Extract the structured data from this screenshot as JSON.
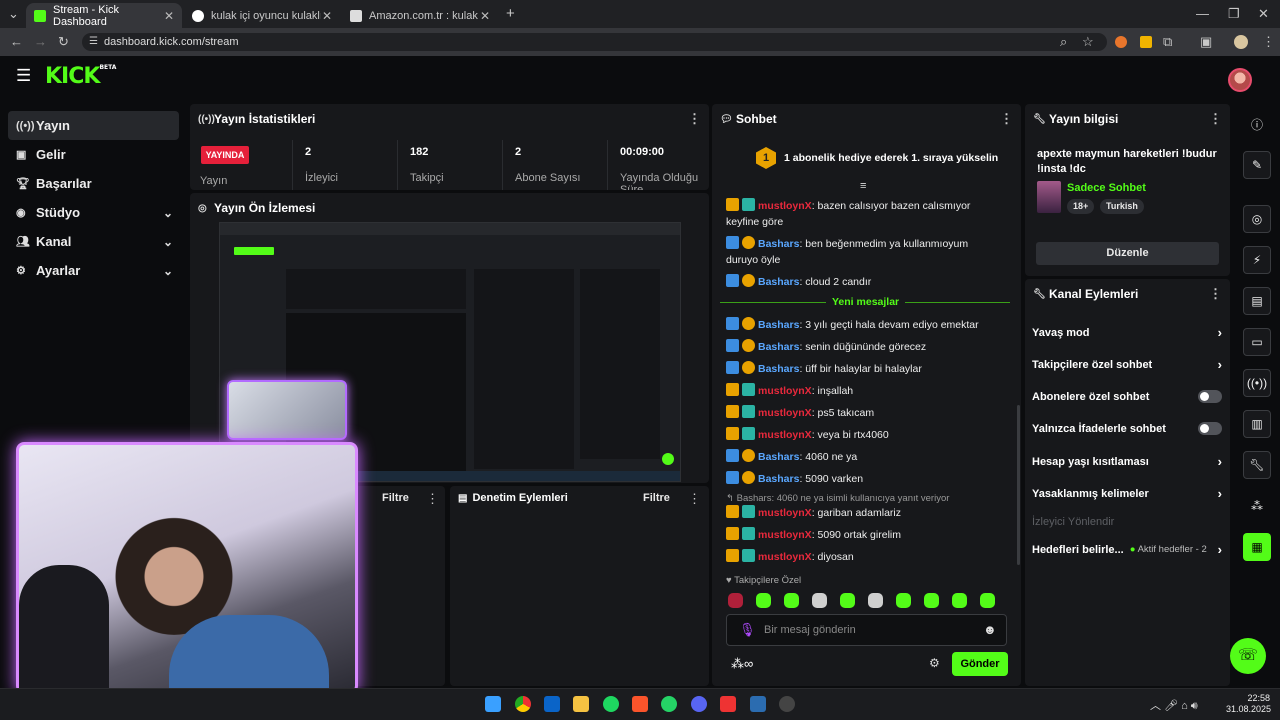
{
  "browser": {
    "tabs": [
      {
        "title": "Stream - Kick Dashboard",
        "active": true
      },
      {
        "title": "kulak içi oyuncu kulaklığı - Goo",
        "active": false
      },
      {
        "title": "Amazon.com.tr : kulak içi oyunc",
        "active": false
      }
    ],
    "url": "dashboard.kick.com/stream"
  },
  "logo": {
    "text": "KICK",
    "beta": "BETA"
  },
  "nav": [
    {
      "label": "Yayın",
      "icon": "broadcast-icon"
    },
    {
      "label": "Gelir",
      "icon": "revenue-icon"
    },
    {
      "label": "Başarılar",
      "icon": "trophy-icon"
    },
    {
      "label": "Stüdyo",
      "icon": "studio-icon"
    },
    {
      "label": "Kanal",
      "icon": "channel-icon"
    },
    {
      "label": "Ayarlar",
      "icon": "settings-icon"
    }
  ],
  "stats": {
    "title": "Yayın İstatistikleri",
    "live_badge": "YAYINDA",
    "status_label": "Yayın",
    "items": [
      {
        "value": "2",
        "label": "İzleyici"
      },
      {
        "value": "182",
        "label": "Takipçi"
      },
      {
        "value": "2",
        "label": "Abone Sayısı"
      },
      {
        "value": "00:09:00",
        "label": "Yayında Olduğu Süre"
      }
    ]
  },
  "preview": {
    "title": "Yayın Ön İzlemesi"
  },
  "lower": {
    "filter_left": "Filtre",
    "mod_actions_title": "Denetim Eylemleri",
    "filter_right": "Filtre"
  },
  "chat": {
    "title": "Sohbet",
    "pinned": "1 abonelik hediye ederek 1. sıraya yükselin",
    "pinned_rank": "1",
    "new_messages": "Yeni mesajlar",
    "messages_before": [
      {
        "user": "mustloynX",
        "text": ": bazen calısıyor bazen calısmıyor keyfine göre",
        "color": "red"
      },
      {
        "user": "Bashars",
        "text": ": ben beğenmedim ya kullanmıoyum duruyo öyle",
        "color": "blue"
      },
      {
        "user": "Bashars",
        "text": ": cloud 2 candır",
        "color": "blue"
      }
    ],
    "messages_after": [
      {
        "user": "Bashars",
        "text": ": 3 yılı geçti hala devam ediyo emektar",
        "color": "blue"
      },
      {
        "user": "Bashars",
        "text": ": senin düğününde görecez",
        "color": "blue"
      },
      {
        "user": "Bashars",
        "text": ": üff bir halaylar bi halaylar",
        "color": "blue"
      },
      {
        "user": "mustloynX",
        "text": ": inşallah",
        "color": "red"
      },
      {
        "user": "mustloynX",
        "text": ": ps5 takıcam",
        "color": "red"
      },
      {
        "user": "mustloynX",
        "text": ": veya bi rtx4060",
        "color": "red"
      },
      {
        "user": "Bashars",
        "text": ": 4060 ne ya",
        "color": "blue"
      },
      {
        "user": "Bashars",
        "text": ": 5090 varken",
        "color": "blue"
      }
    ],
    "reply_hint": "Bashars: 4060 ne ya isimli kullanıcıya yanıt veriyor",
    "messages_reply": [
      {
        "user": "mustloynX",
        "text": ": gariban adamlariz",
        "color": "red"
      },
      {
        "user": "mustloynX",
        "text": ": 5090 ortak girelim",
        "color": "red"
      },
      {
        "user": "mustloynX",
        "text": ": diyosan",
        "color": "red"
      }
    ],
    "followers_only": "Takipçilere Özel",
    "input_placeholder": "Bir mesaj gönderin",
    "send": "Gönder",
    "accent": "#53fc18"
  },
  "stream_info": {
    "title": "Yayın bilgisi",
    "stream_title": "apexte maymun hareketleri !budur !insta !dc",
    "category": "Sadece Sohbet",
    "tags": [
      "18+",
      "Turkish"
    ],
    "edit": "Düzenle"
  },
  "channel_actions": {
    "title": "Kanal Eylemleri",
    "items": [
      {
        "label": "Yavaş mod",
        "control": "arrow"
      },
      {
        "label": "Takipçilere özel sohbet",
        "control": "arrow"
      },
      {
        "label": "Abonelere özel sohbet",
        "control": "toggle"
      },
      {
        "label": "Yalnızca İfadelerle sohbet",
        "control": "toggle"
      },
      {
        "label": "Hesap yaşı kısıtlaması",
        "control": "arrow"
      },
      {
        "label": "Yasaklanmış kelimeler",
        "control": "arrow"
      }
    ],
    "disabled": "İzleyici Yönlendir",
    "goals": "Hedefleri belirle...",
    "goals_status": "Aktif hedefler - 2"
  },
  "taskbar": {
    "time": "22:58",
    "date": "31.08.2025"
  }
}
